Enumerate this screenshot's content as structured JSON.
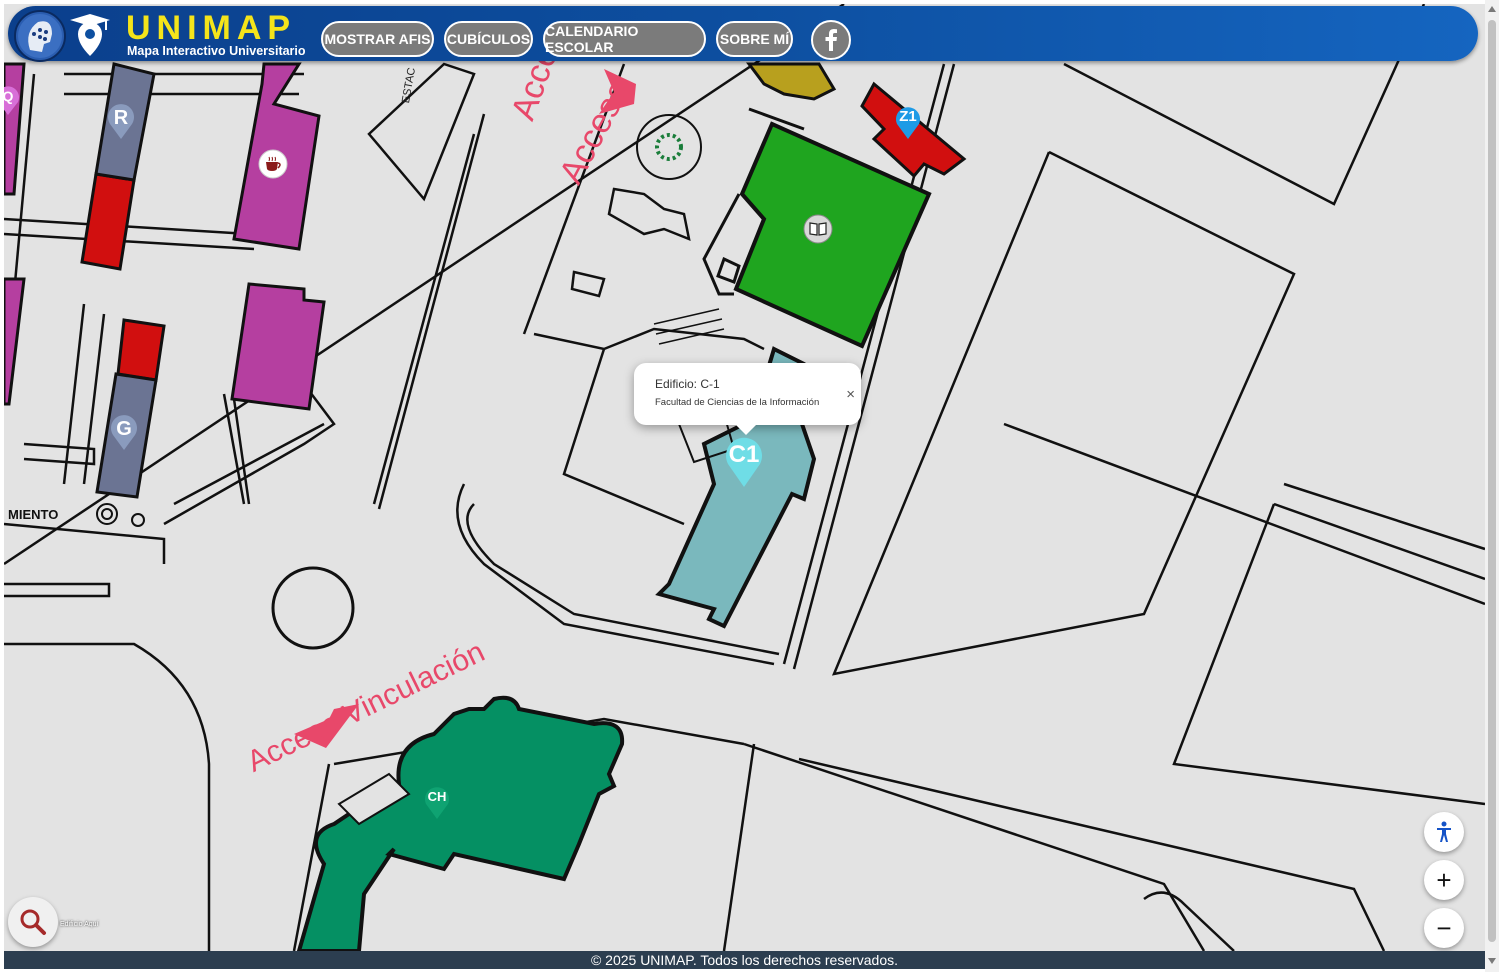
{
  "header": {
    "brand_title": "UNIMAP",
    "brand_subtitle": "Mapa Interactivo Universitario",
    "nav": [
      {
        "label": "MOSTRAR AFIS"
      },
      {
        "label": "CUBÍCULOS"
      },
      {
        "label": "CALENDARIO ESCOLAR"
      },
      {
        "label": "SOBRE MÍ"
      }
    ],
    "social_icon": "facebook-icon"
  },
  "map": {
    "labels": {
      "acceso_top_1": "Acceso",
      "acceso_top_2": "Acceso",
      "acceso_vinculacion": "Acceso Vinculación",
      "estac": "ESTAC",
      "miento": "MIENTO"
    },
    "markers": [
      {
        "label": "R",
        "color": "#8a9bbd"
      },
      {
        "label": "G",
        "color": "#8a9bbd"
      },
      {
        "label": "Z1",
        "color": "#1e9be6"
      },
      {
        "label": "C1",
        "color": "#6fdde6"
      },
      {
        "label": "CH",
        "color": "#0fa372"
      },
      {
        "label": "Q",
        "color": "#d86fd8"
      }
    ],
    "colors": {
      "green_building": "#1fa51f",
      "teal_building": "#7ab8bd",
      "purple_building": "#b53fa0",
      "red_building": "#d10f0f",
      "slate_building": "#6b7493",
      "dark_green_building": "#059063",
      "mustard_building": "#b8a01e",
      "access_text": "#e8486a"
    }
  },
  "popup": {
    "title": "Edificio: C-1",
    "description": "Facultad de Ciencias de la Información",
    "close": "×"
  },
  "controls": {
    "accessibility_icon": "person-icon",
    "zoom_in": "+",
    "zoom_out": "−",
    "search_icon": "search-icon",
    "search_hint": "Edificio Aquí"
  },
  "footer": {
    "text": "© 2025 UNIMAP. Todos los derechos reservados."
  }
}
